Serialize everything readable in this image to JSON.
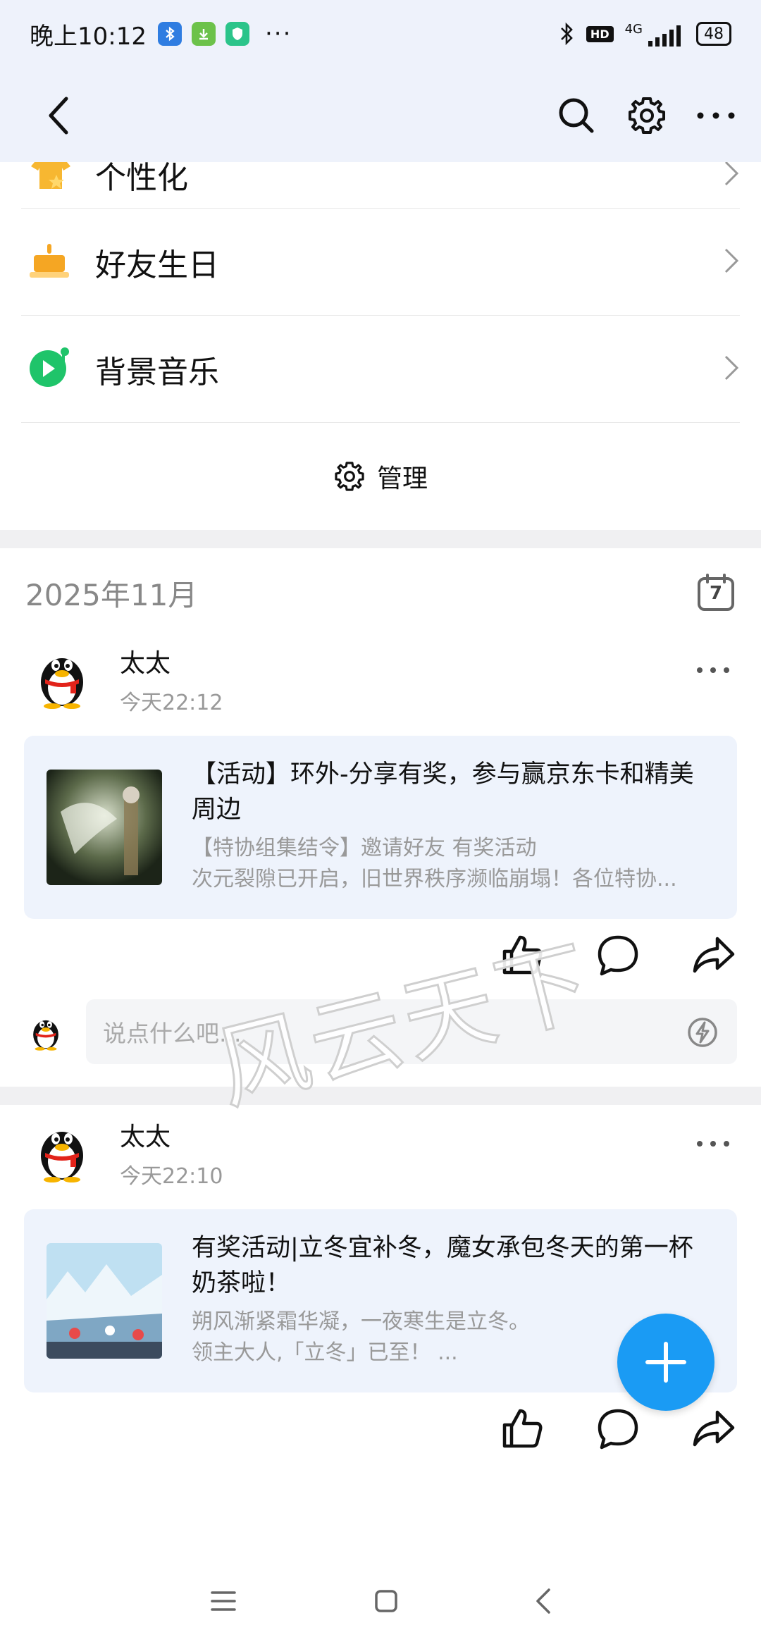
{
  "status_bar": {
    "time": "晚上10:12",
    "dots": "···",
    "network": "4G",
    "hd": "HD",
    "battery": "48"
  },
  "menu": [
    {
      "label": "个性化"
    },
    {
      "label": "好友生日"
    },
    {
      "label": "背景音乐"
    }
  ],
  "manage_label": "管理",
  "month_label": "2025年11月",
  "calendar_day": "7",
  "posts": [
    {
      "author": "太太",
      "time": "今天22:12",
      "title": "【活动】环外-分享有奖，参与赢京东卡和精美周边",
      "sub1": "【特协组集结令】邀请好友 有奖活动",
      "sub2": "次元裂隙已开启，旧世界秩序濒临崩塌！各位特协..."
    },
    {
      "author": "太太",
      "time": "今天22:10",
      "title": "有奖活动|立冬宜补冬，魔女承包冬天的第一杯奶茶啦！",
      "sub1": "朔风渐紧霜华凝，一夜寒生是立冬。",
      "sub2": "领主大人,「立冬」已至！ ..."
    }
  ],
  "comment_placeholder": "说点什么吧...",
  "watermark": "风云天下",
  "colors": {
    "accent": "#1a9bf4",
    "header_bg": "#eef2fb",
    "card_bg": "#eef3fc"
  }
}
